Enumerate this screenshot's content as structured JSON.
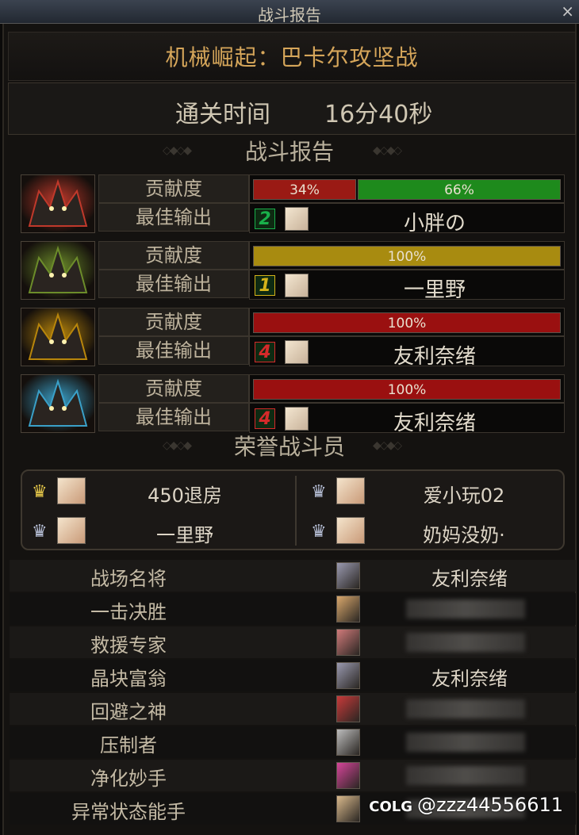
{
  "window": {
    "title": "战斗报告",
    "close_glyph": "×"
  },
  "dungeon_name": "机械崛起：巴卡尔攻坚战",
  "clear_time": {
    "label": "通关时间",
    "value": "16分40秒"
  },
  "report_heading": "战斗报告",
  "bosses": [
    {
      "icon": "red-dragon-boss-icon",
      "accent": "#c0392b",
      "contribution_label": "贡献度",
      "best_label": "最佳输出",
      "bars": [
        {
          "value": "34%",
          "fraction": 0.34,
          "color": "#9a1a14"
        },
        {
          "value": "66%",
          "fraction": 0.66,
          "color": "#1e8a1c"
        }
      ],
      "rank": "2",
      "rank_color": "#19b04a",
      "player": "小胖の"
    },
    {
      "icon": "green-dragon-boss-icon",
      "accent": "#6c8c2a",
      "contribution_label": "贡献度",
      "best_label": "最佳输出",
      "bars": [
        {
          "value": "100%",
          "fraction": 1.0,
          "color": "#a88b10"
        }
      ],
      "rank": "1",
      "rank_color": "#d4b21a",
      "player": "一里野"
    },
    {
      "icon": "gold-dragon-boss-icon",
      "accent": "#b8860b",
      "contribution_label": "贡献度",
      "best_label": "最佳输出",
      "bars": [
        {
          "value": "100%",
          "fraction": 1.0,
          "color": "#9a1010"
        }
      ],
      "rank": "4",
      "rank_color": "#d42a2a",
      "player": "友利奈绪"
    },
    {
      "icon": "blue-dragon-boss-icon",
      "accent": "#3aa0c8",
      "contribution_label": "贡献度",
      "best_label": "最佳输出",
      "bars": [
        {
          "value": "100%",
          "fraction": 1.0,
          "color": "#9a1010"
        }
      ],
      "rank": "4",
      "rank_color": "#d42a2a",
      "player": "友利奈绪"
    }
  ],
  "honor_heading": "荣誉战斗员",
  "honor_members": [
    {
      "name": "450退房",
      "crown": "gold-crown-icon"
    },
    {
      "name": "爱小玩02",
      "crown": "silver-crown-icon"
    },
    {
      "name": "一里野",
      "crown": "silver-crown-icon"
    },
    {
      "name": "奶妈没奶·",
      "crown": "silver-crown-icon"
    }
  ],
  "awards": [
    {
      "title": "战场名将",
      "player": "友利奈绪",
      "avatar_color": "#9a9ab0"
    },
    {
      "title": "一击决胜",
      "player": "",
      "avatar_color": "#d9a86c"
    },
    {
      "title": "救援专家",
      "player": "",
      "avatar_color": "#d07a7a"
    },
    {
      "title": "晶块富翁",
      "player": "友利奈绪",
      "avatar_color": "#9a9ab0"
    },
    {
      "title": "回避之神",
      "player": "",
      "avatar_color": "#c83a3a"
    },
    {
      "title": "压制者",
      "player": "",
      "avatar_color": "#bdbdbd"
    },
    {
      "title": "净化妙手",
      "player": "",
      "avatar_color": "#d6459a"
    },
    {
      "title": "异常状态能手",
      "player": "",
      "avatar_color": "#d9b98c"
    }
  ],
  "watermark": {
    "logo": "COLG",
    "handle": "@zzz44556611"
  }
}
